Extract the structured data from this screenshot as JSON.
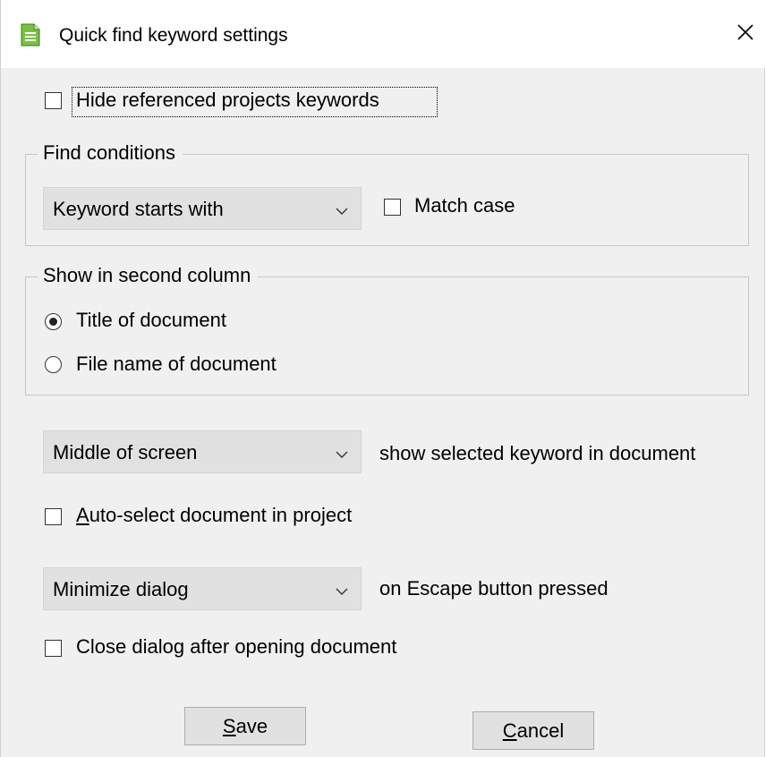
{
  "window": {
    "title": "Quick find keyword settings",
    "icon": "document-icon",
    "close_glyph": "✕"
  },
  "hide_referenced": {
    "label": "Hide referenced projects keywords",
    "checked": false
  },
  "find_conditions": {
    "caption": "Find conditions",
    "mode": {
      "value": "Keyword starts with"
    },
    "match_case": {
      "label": "Match case",
      "checked": false
    }
  },
  "second_column": {
    "caption": "Show in second column",
    "options": [
      {
        "label": "Title of document",
        "selected": true
      },
      {
        "label": "File name of document",
        "selected": false
      }
    ]
  },
  "position": {
    "value": "Middle of screen",
    "suffix": "show selected keyword in document"
  },
  "auto_select": {
    "mnemonic": "A",
    "label_rest": "uto-select document in project",
    "checked": false
  },
  "escape_action": {
    "value": "Minimize dialog",
    "suffix": "on Escape button pressed"
  },
  "close_after_open": {
    "label": "Close dialog after opening document",
    "checked": false
  },
  "buttons": {
    "save": {
      "mnemonic": "S",
      "rest": "ave"
    },
    "cancel": {
      "mnemonic": "C",
      "rest": "ancel"
    }
  }
}
